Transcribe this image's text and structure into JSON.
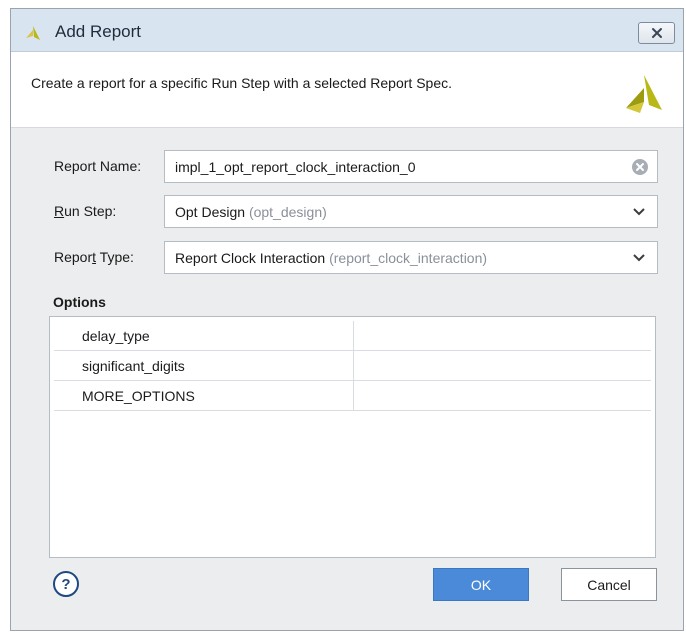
{
  "window": {
    "title": "Add Report"
  },
  "header": {
    "description": "Create a report for a specific Run Step with a selected Report Spec."
  },
  "form": {
    "report_name": {
      "label": "Report Name:",
      "value": "impl_1_opt_report_clock_interaction_0"
    },
    "run_step": {
      "label_mnemonic": "R",
      "label_rest": "un Step:",
      "value": "Opt Design",
      "value_secondary": "(opt_design)"
    },
    "report_type": {
      "label_pre": "Repor",
      "label_mnemonic": "t",
      "label_rest": " Type:",
      "value": "Report Clock Interaction",
      "value_secondary": "(report_clock_interaction)"
    }
  },
  "options": {
    "title": "Options",
    "rows": [
      {
        "name": "delay_type",
        "value": ""
      },
      {
        "name": "significant_digits",
        "value": ""
      },
      {
        "name": "MORE_OPTIONS",
        "value": ""
      }
    ]
  },
  "footer": {
    "help": "?",
    "ok": "OK",
    "cancel": "Cancel"
  },
  "colors": {
    "accent": "#4a8ad8",
    "titlebar": "#d9e4f1",
    "logo": "#b8b817"
  },
  "icons": {
    "app": "vivado-logo-icon",
    "close": "close-icon",
    "clear": "clear-icon",
    "dropdown": "chevron-down-icon",
    "help": "help-icon"
  }
}
